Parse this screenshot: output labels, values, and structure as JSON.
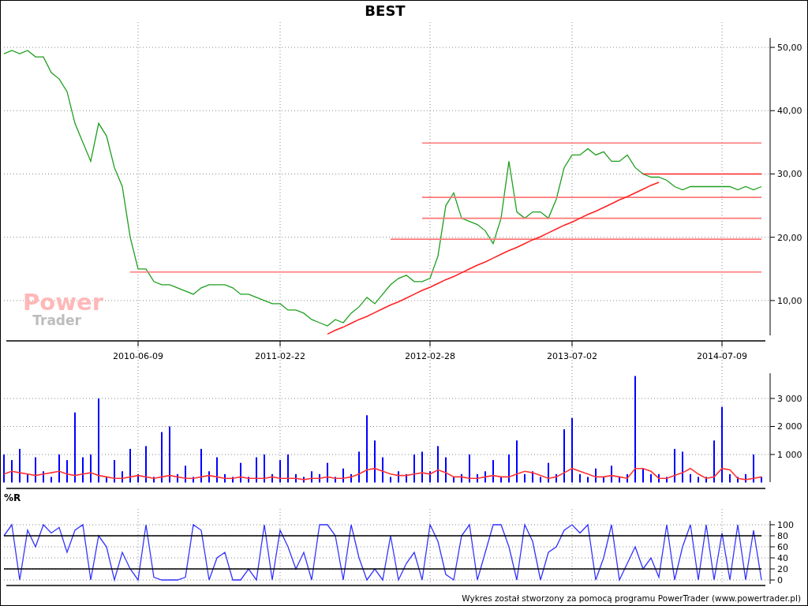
{
  "title": "BEST",
  "watermark": {
    "line_1": "Power",
    "line_2": "Trader"
  },
  "price_panel": {
    "chart_data": {
      "type": "line",
      "grid": true,
      "ylim": [
        4.5,
        51.5
      ],
      "categories": [
        null,
        null,
        null,
        null,
        null,
        null,
        null,
        null,
        null,
        null,
        null,
        null,
        null,
        null,
        null,
        null,
        null,
        "2010-06-09",
        null,
        null,
        null,
        null,
        null,
        null,
        null,
        null,
        null,
        null,
        null,
        null,
        null,
        null,
        null,
        null,
        null,
        "2011-02-22",
        null,
        null,
        null,
        null,
        null,
        null,
        null,
        null,
        null,
        null,
        null,
        null,
        null,
        null,
        null,
        null,
        null,
        null,
        "2012-02-28",
        null,
        null,
        null,
        null,
        null,
        null,
        null,
        null,
        null,
        null,
        null,
        null,
        null,
        null,
        null,
        null,
        null,
        "2013-07-02",
        null,
        null,
        null,
        null,
        null,
        null,
        null,
        null,
        null,
        null,
        null,
        null,
        null,
        null,
        null,
        null,
        null,
        null,
        "2014-07-09",
        null,
        null,
        null,
        null,
        null
      ],
      "yticks": [
        {
          "value": 10,
          "label": "10,00"
        },
        {
          "value": 20,
          "label": "20,00"
        },
        {
          "value": 30,
          "label": "30,00"
        },
        {
          "value": 40,
          "label": "40,00"
        },
        {
          "value": 50,
          "label": "50,00"
        }
      ],
      "series": [
        {
          "color": "#1e9e1e",
          "values": [
            49,
            49.5,
            49,
            49.5,
            48.5,
            48.5,
            46,
            45,
            43,
            38,
            35,
            32,
            38,
            36,
            31,
            28,
            20,
            15,
            15,
            13,
            12.5,
            12.5,
            12,
            11.5,
            11,
            12,
            12.5,
            12.5,
            12.5,
            12,
            11,
            11,
            10.5,
            10,
            9.5,
            9.5,
            8.5,
            8.5,
            8,
            7,
            6.5,
            6,
            7,
            6.5,
            8,
            9,
            10.5,
            9.5,
            11,
            12.5,
            13.5,
            14,
            13,
            13,
            13.5,
            17,
            25,
            27,
            23,
            22.5,
            22,
            21,
            19,
            23,
            32,
            24,
            23,
            24,
            24,
            23,
            26,
            31,
            33,
            33,
            34,
            33,
            33.5,
            32,
            32,
            33,
            31,
            30,
            29.5,
            29.5,
            29,
            28,
            27.5,
            28,
            28,
            28,
            28,
            28,
            28,
            27.5,
            28,
            27.5,
            28
          ]
        },
        {
          "color": "#ff7777",
          "values": [
            null,
            null,
            null,
            null,
            null,
            null,
            null,
            null,
            null,
            null,
            null,
            null,
            null,
            null,
            null,
            null,
            14.5,
            14.5,
            14.5,
            14.5,
            14.5,
            14.5,
            14.5,
            14.5,
            14.5,
            14.5,
            14.5,
            14.5,
            14.5,
            14.5,
            14.5,
            14.5,
            14.5,
            14.5,
            14.5,
            14.5,
            14.5,
            14.5,
            14.5,
            14.5,
            14.5,
            14.5,
            14.5,
            14.5,
            14.5,
            14.5,
            14.5,
            14.5,
            14.5,
            14.5,
            14.5,
            14.5,
            14.5,
            14.5,
            14.5,
            14.5,
            14.5,
            14.5,
            14.5,
            14.5,
            14.5,
            14.5,
            14.5,
            14.5,
            14.5,
            14.5,
            14.5,
            14.5,
            14.5,
            14.5,
            14.5,
            14.5,
            14.5,
            14.5,
            14.5,
            14.5,
            14.5,
            14.5,
            14.5,
            14.5,
            14.5,
            14.5,
            14.5,
            14.5,
            14.5,
            14.5,
            14.5,
            14.5,
            14.5,
            14.5,
            14.5,
            14.5,
            14.5,
            14.5,
            14.5,
            14.5,
            14.5
          ]
        },
        {
          "color": "#ff7777",
          "values": [
            null,
            null,
            null,
            null,
            null,
            null,
            null,
            null,
            null,
            null,
            null,
            null,
            null,
            null,
            null,
            null,
            null,
            null,
            null,
            null,
            null,
            null,
            null,
            null,
            null,
            null,
            null,
            null,
            null,
            null,
            null,
            null,
            null,
            null,
            null,
            null,
            null,
            null,
            null,
            null,
            null,
            null,
            null,
            null,
            null,
            null,
            null,
            null,
            null,
            19.7,
            19.7,
            19.7,
            19.7,
            19.7,
            19.7,
            19.7,
            19.7,
            19.7,
            19.7,
            19.7,
            19.7,
            19.7,
            19.7,
            19.7,
            19.7,
            19.7,
            19.7,
            19.7,
            19.7,
            19.7,
            19.7,
            19.7,
            19.7,
            19.7,
            19.7,
            19.7,
            19.7,
            19.7,
            19.7,
            19.7,
            19.7,
            19.7,
            19.7,
            19.7,
            19.7,
            19.7,
            19.7,
            19.7,
            19.7,
            19.7,
            19.7,
            19.7,
            19.7,
            19.7,
            19.7,
            19.7,
            19.7
          ]
        },
        {
          "color": "#ff7777",
          "values": [
            null,
            null,
            null,
            null,
            null,
            null,
            null,
            null,
            null,
            null,
            null,
            null,
            null,
            null,
            null,
            null,
            null,
            null,
            null,
            null,
            null,
            null,
            null,
            null,
            null,
            null,
            null,
            null,
            null,
            null,
            null,
            null,
            null,
            null,
            null,
            null,
            null,
            null,
            null,
            null,
            null,
            null,
            null,
            null,
            null,
            null,
            null,
            null,
            null,
            null,
            null,
            null,
            null,
            23,
            23,
            23,
            23,
            23,
            23,
            23,
            23,
            23,
            23,
            23,
            23,
            23,
            23,
            23,
            23,
            23,
            23,
            23,
            23,
            23,
            23,
            23,
            23,
            23,
            23,
            23,
            23,
            23,
            23,
            23,
            23,
            23,
            23,
            23,
            23,
            23,
            23,
            23,
            23,
            23,
            23,
            23,
            23
          ]
        },
        {
          "color": "#ff7777",
          "values": [
            null,
            null,
            null,
            null,
            null,
            null,
            null,
            null,
            null,
            null,
            null,
            null,
            null,
            null,
            null,
            null,
            null,
            null,
            null,
            null,
            null,
            null,
            null,
            null,
            null,
            null,
            null,
            null,
            null,
            null,
            null,
            null,
            null,
            null,
            null,
            null,
            null,
            null,
            null,
            null,
            null,
            null,
            null,
            null,
            null,
            null,
            null,
            null,
            null,
            null,
            null,
            null,
            null,
            26.3,
            26.3,
            26.3,
            26.3,
            26.3,
            26.3,
            26.3,
            26.3,
            26.3,
            26.3,
            26.3,
            26.3,
            26.3,
            26.3,
            26.3,
            26.3,
            26.3,
            26.3,
            26.3,
            26.3,
            26.3,
            26.3,
            26.3,
            26.3,
            26.3,
            26.3,
            26.3,
            26.3,
            26.3,
            26.3,
            26.3,
            26.3,
            26.3,
            26.3,
            26.3,
            26.3,
            26.3,
            26.3,
            26.3,
            26.3,
            26.3,
            26.3,
            26.3,
            26.3
          ]
        },
        {
          "color": "#ff7777",
          "values": [
            null,
            null,
            null,
            null,
            null,
            null,
            null,
            null,
            null,
            null,
            null,
            null,
            null,
            null,
            null,
            null,
            null,
            null,
            null,
            null,
            null,
            null,
            null,
            null,
            null,
            null,
            null,
            null,
            null,
            null,
            null,
            null,
            null,
            null,
            null,
            null,
            null,
            null,
            null,
            null,
            null,
            null,
            null,
            null,
            null,
            null,
            null,
            null,
            null,
            null,
            null,
            null,
            null,
            34.9,
            34.9,
            34.9,
            34.9,
            34.9,
            34.9,
            34.9,
            34.9,
            34.9,
            34.9,
            34.9,
            34.9,
            34.9,
            34.9,
            34.9,
            34.9,
            34.9,
            34.9,
            34.9,
            34.9,
            34.9,
            34.9,
            34.9,
            34.9,
            34.9,
            34.9,
            34.9,
            34.9,
            34.9,
            34.9,
            34.9,
            34.9,
            34.9,
            34.9,
            34.9,
            34.9,
            34.9,
            34.9,
            34.9,
            34.9,
            34.9,
            34.9,
            34.9,
            34.9
          ]
        },
        {
          "color": "#ff2222",
          "values": [
            null,
            null,
            null,
            null,
            null,
            null,
            null,
            null,
            null,
            null,
            null,
            null,
            null,
            null,
            null,
            null,
            null,
            null,
            null,
            null,
            null,
            null,
            null,
            null,
            null,
            null,
            null,
            null,
            null,
            null,
            null,
            null,
            null,
            null,
            null,
            null,
            null,
            null,
            null,
            null,
            null,
            null,
            null,
            null,
            null,
            null,
            null,
            null,
            null,
            null,
            null,
            null,
            null,
            null,
            null,
            null,
            null,
            null,
            null,
            null,
            null,
            null,
            null,
            null,
            null,
            null,
            null,
            null,
            null,
            null,
            null,
            null,
            null,
            null,
            null,
            null,
            null,
            null,
            null,
            null,
            null,
            30,
            30,
            30,
            30,
            30,
            30,
            30,
            30,
            30,
            30,
            30,
            30,
            30,
            30,
            30,
            30
          ]
        },
        {
          "color": "#ff2222",
          "values": [
            null,
            null,
            null,
            null,
            null,
            null,
            null,
            null,
            null,
            null,
            null,
            null,
            null,
            null,
            null,
            null,
            null,
            null,
            null,
            null,
            null,
            null,
            null,
            null,
            null,
            null,
            null,
            null,
            null,
            null,
            null,
            null,
            null,
            null,
            null,
            null,
            null,
            null,
            null,
            null,
            null,
            4.7,
            5.3,
            5.8,
            6.4,
            7.0,
            7.5,
            8.1,
            8.7,
            9.3,
            9.8,
            10.4,
            11.0,
            11.6,
            12.1,
            12.7,
            13.3,
            13.8,
            14.4,
            15.0,
            15.6,
            16.1,
            16.7,
            17.3,
            17.9,
            18.4,
            19.0,
            19.6,
            20.1,
            20.7,
            21.3,
            21.9,
            22.4,
            23.0,
            23.6,
            24.1,
            24.7,
            25.3,
            25.9,
            26.4,
            27.0,
            27.6,
            28.2,
            28.7,
            null,
            null,
            null,
            null,
            null,
            null,
            null,
            null,
            null,
            null,
            null,
            null,
            null
          ]
        }
      ]
    }
  },
  "volume_panel": {
    "chart_data": {
      "type": "bar",
      "stacked": false,
      "grid": true,
      "ylim": [
        0,
        3900
      ],
      "yticks": [
        {
          "value": 1000,
          "label": "1 000"
        },
        {
          "value": 2000,
          "label": "2 000"
        },
        {
          "value": 3000,
          "label": "3 000"
        }
      ],
      "series": [
        {
          "type": "bar",
          "color": "#0000ff",
          "values": [
            1000,
            800,
            1200,
            300,
            900,
            400,
            200,
            1000,
            800,
            2500,
            900,
            1000,
            3000,
            200,
            800,
            400,
            1200,
            300,
            1300,
            200,
            1800,
            2000,
            300,
            600,
            200,
            1200,
            400,
            900,
            300,
            200,
            700,
            200,
            900,
            1000,
            300,
            800,
            1000,
            300,
            200,
            400,
            300,
            700,
            200,
            500,
            300,
            1100,
            2400,
            1500,
            900,
            200,
            400,
            300,
            1000,
            1100,
            400,
            1300,
            900,
            200,
            300,
            1000,
            300,
            400,
            800,
            200,
            1000,
            1500,
            300,
            400,
            200,
            700,
            300,
            1900,
            2300,
            300,
            200,
            500,
            200,
            600,
            200,
            300,
            3800,
            500,
            300,
            300,
            200,
            1200,
            1100,
            300,
            200,
            200,
            1500,
            2700,
            300,
            200,
            300,
            1000,
            200
          ]
        },
        {
          "type": "line",
          "color": "#ff3333",
          "values": [
            300,
            400,
            350,
            300,
            250,
            300,
            350,
            400,
            300,
            250,
            300,
            350,
            250,
            200,
            150,
            150,
            200,
            250,
            200,
            150,
            200,
            250,
            200,
            150,
            150,
            200,
            250,
            200,
            150,
            150,
            200,
            150,
            150,
            150,
            200,
            150,
            150,
            150,
            100,
            150,
            150,
            200,
            150,
            150,
            200,
            300,
            450,
            500,
            400,
            300,
            250,
            250,
            300,
            350,
            300,
            450,
            350,
            200,
            200,
            150,
            150,
            200,
            250,
            200,
            200,
            300,
            400,
            350,
            250,
            150,
            200,
            350,
            500,
            400,
            300,
            200,
            200,
            250,
            200,
            150,
            500,
            500,
            400,
            150,
            150,
            250,
            350,
            500,
            300,
            150,
            200,
            500,
            450,
            150,
            100,
            150,
            200
          ]
        }
      ]
    }
  },
  "williams_panel": {
    "label": "%R",
    "chart_data": {
      "type": "line",
      "grid": true,
      "ylim": [
        0,
        100
      ],
      "yticks": [
        0,
        20,
        40,
        60,
        80,
        100
      ],
      "series": [
        {
          "color": "#3333ff",
          "values": [
            80,
            100,
            0,
            90,
            60,
            100,
            85,
            95,
            50,
            90,
            100,
            0,
            80,
            60,
            0,
            50,
            20,
            0,
            100,
            5,
            0,
            0,
            0,
            5,
            100,
            90,
            0,
            40,
            50,
            0,
            0,
            20,
            0,
            100,
            0,
            90,
            60,
            20,
            50,
            0,
            100,
            100,
            80,
            0,
            100,
            40,
            0,
            20,
            0,
            80,
            0,
            30,
            50,
            0,
            100,
            70,
            10,
            0,
            80,
            100,
            0,
            50,
            100,
            100,
            60,
            0,
            100,
            70,
            0,
            50,
            60,
            90,
            100,
            85,
            100,
            0,
            40,
            100,
            0,
            30,
            60,
            20,
            40,
            5,
            100,
            0,
            60,
            100,
            0,
            100,
            0,
            85,
            0,
            100,
            0,
            90,
            0
          ]
        },
        {
          "color": "#000000",
          "values": [
            80,
            80,
            80,
            80,
            80,
            80,
            80,
            80,
            80,
            80,
            80,
            80,
            80,
            80,
            80,
            80,
            80,
            80,
            80,
            80,
            80,
            80,
            80,
            80,
            80,
            80,
            80,
            80,
            80,
            80,
            80,
            80,
            80,
            80,
            80,
            80,
            80,
            80,
            80,
            80,
            80,
            80,
            80,
            80,
            80,
            80,
            80,
            80,
            80,
            80,
            80,
            80,
            80,
            80,
            80,
            80,
            80,
            80,
            80,
            80,
            80,
            80,
            80,
            80,
            80,
            80,
            80,
            80,
            80,
            80,
            80,
            80,
            80,
            80,
            80,
            80,
            80,
            80,
            80,
            80,
            80,
            80,
            80,
            80,
            80,
            80,
            80,
            80,
            80,
            80,
            80,
            80,
            80,
            80,
            80,
            80,
            80
          ]
        },
        {
          "color": "#000000",
          "values": [
            20,
            20,
            20,
            20,
            20,
            20,
            20,
            20,
            20,
            20,
            20,
            20,
            20,
            20,
            20,
            20,
            20,
            20,
            20,
            20,
            20,
            20,
            20,
            20,
            20,
            20,
            20,
            20,
            20,
            20,
            20,
            20,
            20,
            20,
            20,
            20,
            20,
            20,
            20,
            20,
            20,
            20,
            20,
            20,
            20,
            20,
            20,
            20,
            20,
            20,
            20,
            20,
            20,
            20,
            20,
            20,
            20,
            20,
            20,
            20,
            20,
            20,
            20,
            20,
            20,
            20,
            20,
            20,
            20,
            20,
            20,
            20,
            20,
            20,
            20,
            20,
            20,
            20,
            20,
            20,
            20,
            20,
            20,
            20,
            20,
            20,
            20,
            20,
            20,
            20,
            20,
            20,
            20,
            20,
            20,
            20,
            20
          ]
        }
      ]
    }
  },
  "footer": "Wykres został stworzony za pomocą programu PowerTrader (www.powertrader.pl)"
}
